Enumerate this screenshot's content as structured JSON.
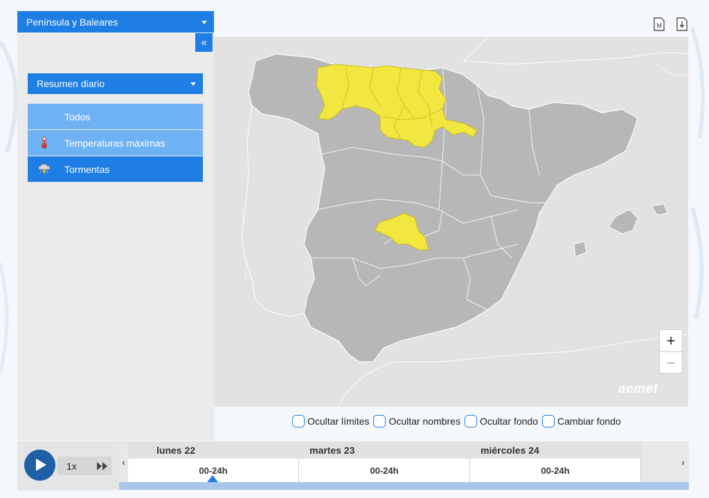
{
  "region_selector": {
    "label": "Península y Baleares"
  },
  "panel": {
    "collapse_label": "«",
    "summary_selector": {
      "label": "Resumen diario"
    },
    "layers": [
      {
        "label": "Todos",
        "icon": "none"
      },
      {
        "label": "Temperaturas máximas",
        "icon": "thermometer-icon"
      },
      {
        "label": "Tormentas",
        "icon": "storm-icon"
      }
    ]
  },
  "map": {
    "alert_color": "#f2e641",
    "land_color": "#b7b7b7",
    "sea_color": "#e2e2e2",
    "brand": "aemet",
    "zoom_in_label": "+",
    "zoom_out_label": "−"
  },
  "toolbar": {
    "icons": [
      "markdown-icon",
      "download-icon"
    ],
    "m_label": "M"
  },
  "options": [
    {
      "label": "Ocultar límites"
    },
    {
      "label": "Ocultar nombres"
    },
    {
      "label": "Ocultar fondo"
    },
    {
      "label": "Cambiar fondo"
    }
  ],
  "timeline": {
    "speed": "1x",
    "prev_label": "‹",
    "next_label": "›",
    "days": [
      {
        "name": "lunes 22",
        "slot": "00-24h"
      },
      {
        "name": "martes 23",
        "slot": "00-24h"
      },
      {
        "name": "miércoles 24",
        "slot": "00-24h"
      }
    ]
  },
  "colors": {
    "accent": "#1f7ee3",
    "accent_light": "#6fb2f3",
    "play": "#1f5fa6"
  }
}
